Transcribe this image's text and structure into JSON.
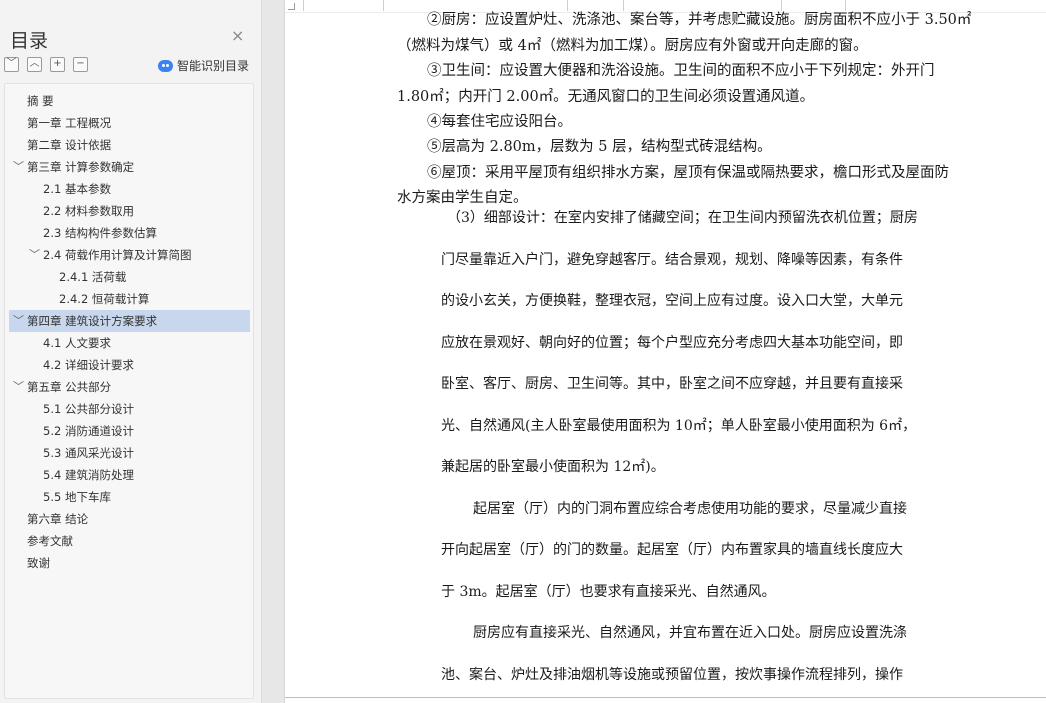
{
  "sidebar": {
    "title": "目录",
    "close_icon": "×",
    "tools": [
      "﹀",
      "︿",
      "+",
      "−"
    ],
    "ai_button": "智能识别目录",
    "toc": [
      {
        "label": "摘  要"
      },
      {
        "label": "第一章  工程概况"
      },
      {
        "label": "第二章  设计依据"
      },
      {
        "label": "第三章  计算参数确定"
      },
      {
        "label": "2.1  基本参数"
      },
      {
        "label": "2.2  材料参数取用"
      },
      {
        "label": "2.3  结构构件参数估算"
      },
      {
        "label": "2.4  荷载作用计算及计算简图"
      },
      {
        "label": "2.4.1  活荷载"
      },
      {
        "label": "2.4.2  恒荷载计算"
      },
      {
        "label": "第四章  建筑设计方案要求"
      },
      {
        "label": "4.1 人文要求"
      },
      {
        "label": "4.2 详细设计要求"
      },
      {
        "label": "第五章  公共部分"
      },
      {
        "label": "5.1 公共部分设计"
      },
      {
        "label": "5.2 消防通道设计"
      },
      {
        "label": "5.3 通风采光设计"
      },
      {
        "label": "5.4 建筑消防处理"
      },
      {
        "label": "5.5 地下车库"
      },
      {
        "label": "第六章  结论"
      },
      {
        "label": "参考文献"
      },
      {
        "label": "致谢"
      }
    ]
  },
  "document": {
    "lines": [
      "②厨房：应设置炉灶、洗涤池、案台等，并考虑贮藏设施。厨房面积不应小于 3.50㎡",
      "（燃料为煤气）或 4㎡（燃料为加工煤）。厨房应有外窗或开向走廊的窗。",
      "③卫生间：应设置大便器和洗浴设施。卫生间的面积不应小于下列规定：外开门",
      "1.80㎡；内开门 2.00㎡。无通风窗口的卫生间必须设置通风道。",
      "④每套住宅应设阳台。",
      "⑤层高为 2.80m，层数为 5 层，结构型式砖混结构。",
      "⑥屋顶：采用平屋顶有组织排水方案，屋顶有保温或隔热要求，檐口形式及屋面防",
      "水方案由学生自定。",
      "（3）细部设计：在室内安排了储藏空间；在卫生间内预留洗衣机位置；厨房",
      "门尽量靠近入户门，避免穿越客厅。结合景观，规划、降噪等因素，有条件",
      "的设小玄关，方便换鞋，整理衣冠，空间上应有过度。设入口大堂，大单元",
      "应放在景观好、朝向好的位置；每个户型应充分考虑四大基本功能空间，即",
      "卧室、客厅、厨房、卫生间等。其中，卧室之间不应穿越，并且要有直接采",
      "光、自然通风(主人卧室最使用面积为 10㎡；单人卧室最小使用面积为 6㎡，",
      "兼起居的卧室最小使面积为 12㎡)。",
      "起居室（厅）内的门洞布置应综合考虑使用功能的要求，尽量减少直接",
      "开向起居室（厅）的门的数量。起居室（厅）内布置家具的墙直线长度应大",
      "于 3m。起居室（厅）也要求有直接采光、自然通风。",
      "厨房应有直接采光、自然通风，并宜布置在近入口处。厨房应设置洗涤",
      "池、案台、炉灶及排油烟机等设施或预留位置，按炊事操作流程排列，操作"
    ]
  }
}
